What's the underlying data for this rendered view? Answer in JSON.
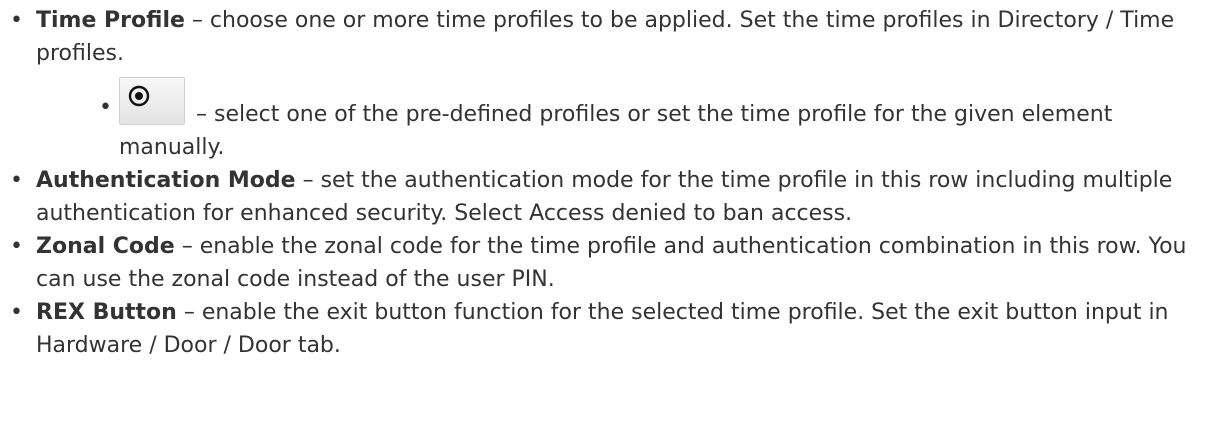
{
  "items": [
    {
      "term": "Time Profile",
      "text": " – choose one or more time profiles to be applied. Set the time profiles in Directory / Time profiles.",
      "sub": {
        "icon": "radio-select-icon",
        "text": " – select one of the pre-defined profiles or set the time profile for the given element manually."
      }
    },
    {
      "term": "Authentication Mode",
      "text": " – set the authentication mode for the time profile in this row including multiple authentication for enhanced security. Select Access denied to ban access."
    },
    {
      "term": "Zonal Code",
      "text": " – enable the zonal code for the time profile and authentication combination in this row. You can use the zonal code instead of the user PIN."
    },
    {
      "term": "REX Button",
      "text": " – enable the exit button function for the selected time profile. Set the exit button input in Hardware / Door / Door tab."
    }
  ]
}
